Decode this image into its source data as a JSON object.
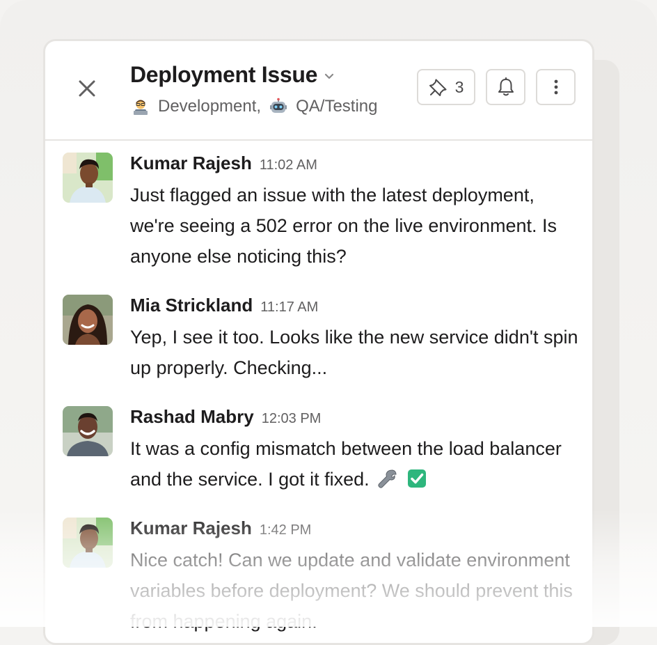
{
  "thread": {
    "title": "Deployment Issue",
    "channels": [
      {
        "emoji": "technologist-emoji",
        "name": "Development"
      },
      {
        "emoji": "robot-emoji",
        "name": "QA/Testing"
      }
    ],
    "separator": ",",
    "pinned_count": "3"
  },
  "messages": [
    {
      "author": "Kumar Rajesh",
      "time": "11:02 AM",
      "text": "Just flagged an issue with the latest deployment, we're seeing a 502 error on the live environment. Is anyone else noticing this?"
    },
    {
      "author": "Mia Strickland",
      "time": "11:17 AM",
      "text": "Yep, I see it too. Looks like the new service didn't spin up properly. Checking..."
    },
    {
      "author": "Rashad Mabry",
      "time": "12:03 PM",
      "text": "It was a config mismatch between the load balancer and the service. I got it fixed."
    },
    {
      "author": "Kumar Rajesh",
      "time": "1:42 PM",
      "text": "Nice catch! Can we update and validate environment variables before deployment? We should prevent this from happening again."
    }
  ],
  "colors": {
    "text_primary": "#1d1c1d",
    "text_secondary": "#616061",
    "border": "#e6e4e1",
    "check_green": "#2eb67d"
  }
}
